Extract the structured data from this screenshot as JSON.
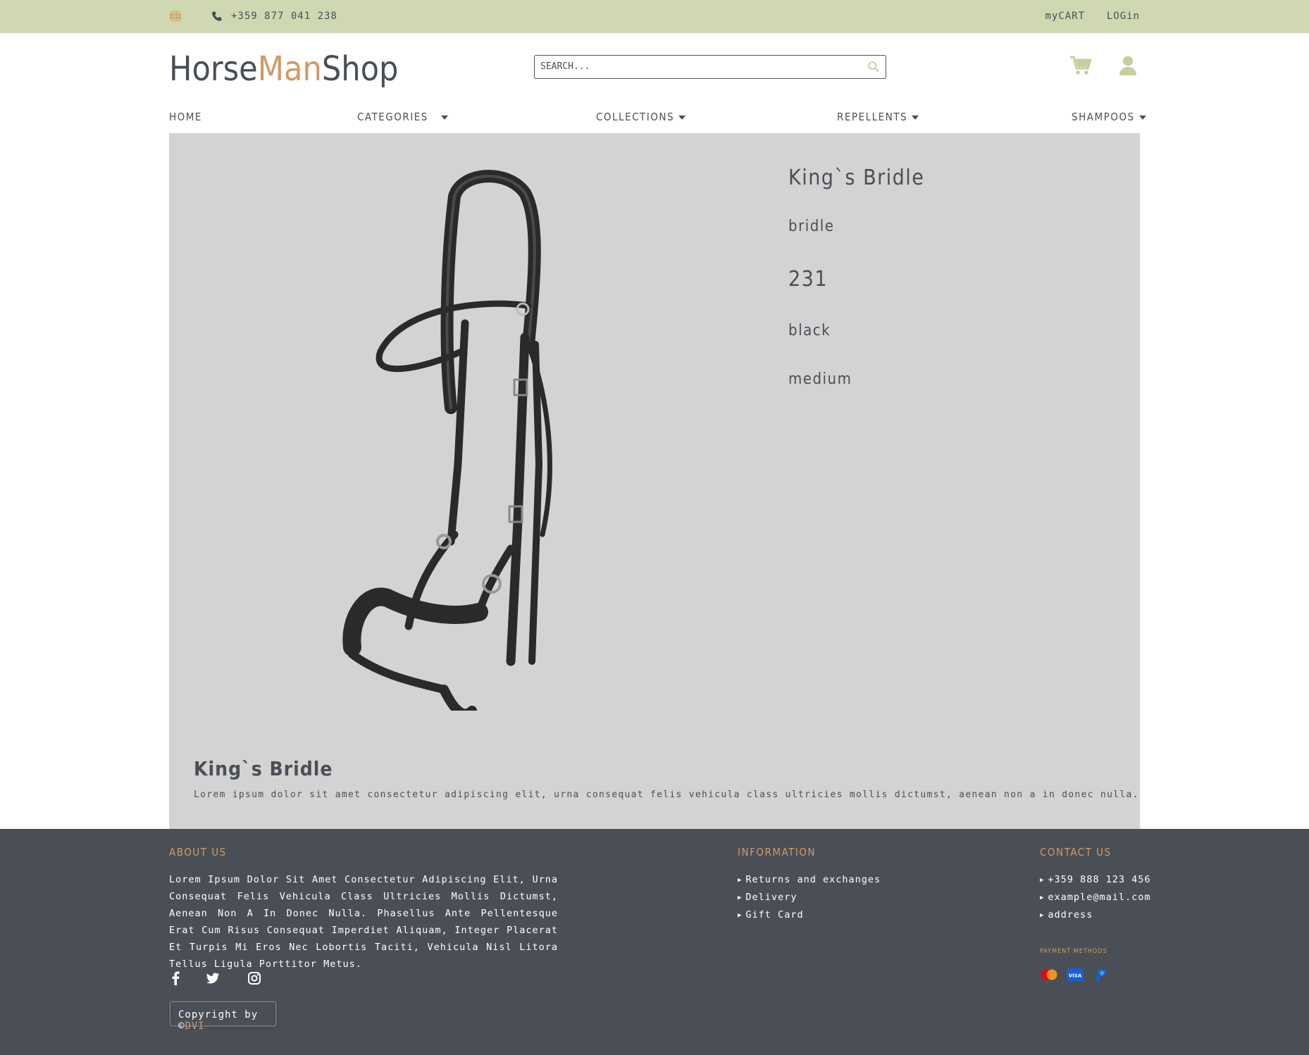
{
  "topbar": {
    "phone": "+359 877 041 238",
    "my_cart": "myCART",
    "login": "LOGin",
    "icons": {
      "globe": "globe-icon",
      "phone": "phone-icon"
    }
  },
  "header": {
    "logo": {
      "part1": "Horse",
      "part2": "Man",
      "part3": "Shop"
    },
    "search_placeholder": "SEARCH...",
    "icons": {
      "search": "search-icon",
      "cart": "cart-icon",
      "user": "user-icon"
    }
  },
  "nav": {
    "home": "HOME",
    "categories": "CATEGORIES",
    "collections": "COLLECTIONS",
    "repellents": "REPELLENTS",
    "shampoos": "SHAMPOOS"
  },
  "product": {
    "name": "King`s Bridle",
    "type": "bridle",
    "price": "231",
    "color": "black",
    "size": "medium",
    "description_title": "King`s Bridle",
    "description": "Lorem ipsum dolor sit amet consectetur adipiscing elit, urna consequat felis vehicula class ultricies mollis dictumst, aenean non a in donec nulla."
  },
  "footer": {
    "about": {
      "heading": "ABOUT US",
      "text": "Lorem Ipsum Dolor Sit Amet Consectetur Adipiscing Elit, Urna Consequat Felis Vehicula Class Ultricies Mollis Dictumst, Aenean Non A In Donec Nulla. Phasellus Ante Pellentesque Erat Cum Risus Consequat Imperdiet Aliquam, Integer Placerat Et Turpis Mi Eros Nec Lobortis Taciti, Vehicula Nisl Litora Tellus Ligula Porttitor Metus."
    },
    "information": {
      "heading": "INFORMATION",
      "items": [
        "Returns and exchanges",
        "Delivery",
        "Gift Card"
      ]
    },
    "contact": {
      "heading": "CONTACT US",
      "items": [
        "+359 888 123 456",
        "example@mail.com",
        "address"
      ]
    },
    "payment_heading": "PAYMENT METHODS",
    "payment_icons": [
      "mastercard-icon",
      "visa-icon",
      "paypal-icon"
    ],
    "social_icons": [
      "facebook-icon",
      "twitter-icon",
      "instagram-icon"
    ],
    "copyright": {
      "text": "Copyright by ©",
      "brand": "DVI"
    }
  },
  "colors": {
    "topbar_bg": "#cfd8b1",
    "accent": "#d19a66",
    "text_dark": "#4a4f57",
    "panel_bg": "#d3d3d3",
    "footer_bg": "#4a4f57",
    "icon_green": "#c3cf9d"
  }
}
